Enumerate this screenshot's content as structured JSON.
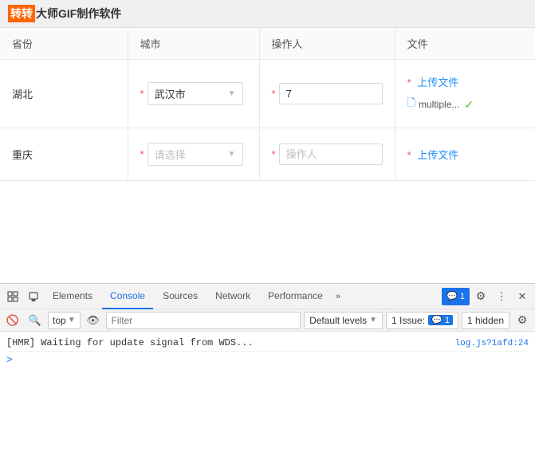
{
  "titleBar": {
    "highlight": "转转",
    "rest": "大师GIF制作软件"
  },
  "table": {
    "headers": [
      "省份",
      "城市",
      "操作人",
      "文件"
    ],
    "rows": [
      {
        "province": "湖北",
        "city": {
          "type": "select",
          "value": "武汉市",
          "placeholder": ""
        },
        "operator": {
          "type": "input",
          "value": "7",
          "placeholder": "操作人"
        },
        "file": {
          "uploadLabel": "上传文件",
          "fileName": "multiple...",
          "hasFile": true
        }
      },
      {
        "province": "重庆",
        "city": {
          "type": "select",
          "value": "",
          "placeholder": "请选择"
        },
        "operator": {
          "type": "input",
          "value": "",
          "placeholder": "操作人"
        },
        "file": {
          "uploadLabel": "上传文件",
          "fileName": "",
          "hasFile": false
        }
      }
    ]
  },
  "devtools": {
    "tabs": [
      {
        "id": "elements",
        "label": "Elements",
        "active": false
      },
      {
        "id": "console",
        "label": "Console",
        "active": true
      },
      {
        "id": "sources",
        "label": "Sources",
        "active": false
      },
      {
        "id": "network",
        "label": "Network",
        "active": false
      },
      {
        "id": "performance",
        "label": "Performance",
        "active": false
      }
    ],
    "moreTabs": "»",
    "badgeCount": "1",
    "toolbar": {
      "topLevel": "top",
      "filterPlaceholder": "Filter",
      "defaultLevels": "Default levels",
      "issueLabel": "1 Issue:",
      "issueCount": "1",
      "hiddenCount": "1 hidden"
    },
    "console": {
      "logMessage": "[HMR] Waiting for update signal from WDS...",
      "logLink": "log.js?1afd:24",
      "promptSymbol": ">"
    }
  }
}
